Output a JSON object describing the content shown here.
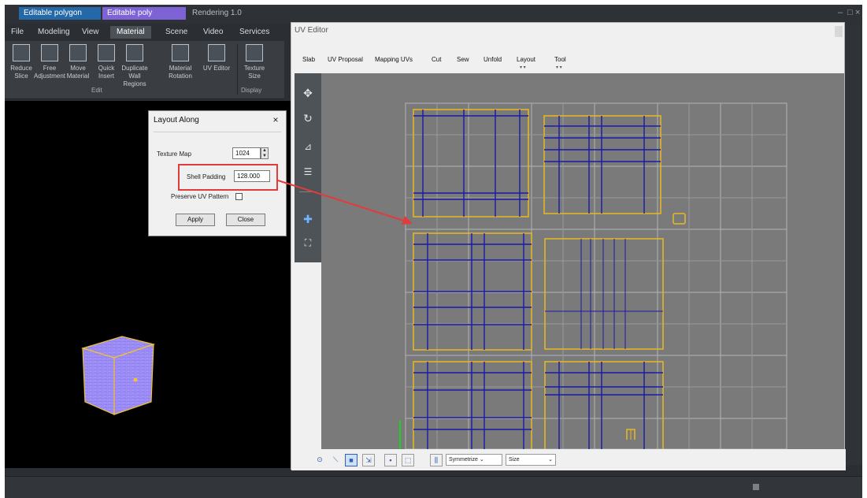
{
  "titlebar": {
    "tabs": [
      "Editable polygon",
      "Editable poly"
    ],
    "doc_title": "Rendering 1.0",
    "window_controls": [
      "–",
      "□",
      "×"
    ]
  },
  "menubar": {
    "items": [
      "File",
      "Modeling",
      "View",
      "Material",
      "Scene",
      "Video",
      "Services"
    ],
    "active": "Material"
  },
  "ribbon": {
    "buttons": [
      "Reduce Slice",
      "Free Adjustment",
      "Move Material",
      "Quick Insert",
      "Duplicate Wall Regions",
      "Material Rotation",
      "UV Editor",
      "Texture Size"
    ],
    "groups": [
      "Edit",
      "Display"
    ]
  },
  "layout_dialog": {
    "title": "Layout Along",
    "close": "×",
    "texture_map_label": "Texture Map",
    "texture_map_value": "1024",
    "shell_padding_label": "Shell Padding",
    "shell_padding_value": "128.000",
    "preserve_label": "Preserve UV Pattern",
    "apply_label": "Apply",
    "close_label": "Close"
  },
  "uv_editor": {
    "title": "UV Editor",
    "menu": [
      {
        "label": "Slab",
        "sub": ""
      },
      {
        "label": "UV Proposal",
        "sub": ""
      },
      {
        "label": "Mapping UVs",
        "sub": ""
      },
      {
        "label": "Cut",
        "sub": ""
      },
      {
        "label": "Sew",
        "sub": ""
      },
      {
        "label": "Unfold",
        "sub": ""
      },
      {
        "label": "Layout",
        "sub": "▾ ▾"
      },
      {
        "label": "Tool",
        "sub": "▾ ▾"
      }
    ],
    "left_tools": [
      "move-tool",
      "rotate-tool",
      "scale-tool",
      "align-tool",
      "separator",
      "center-tool",
      "frame-tool"
    ],
    "bottom": {
      "symmetry_option": "Symmetrize",
      "size_option": "Size"
    }
  },
  "colors": {
    "uv_background": "#7a7a7a",
    "shell_border": "#e8b923",
    "uv_edge": "#1a1aa8",
    "highlight": "#e23b3b",
    "cube": "#8f7ff0"
  }
}
